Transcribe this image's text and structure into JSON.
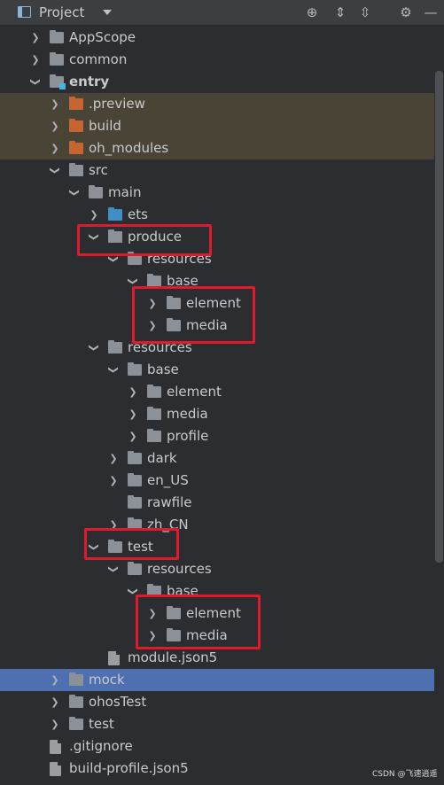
{
  "panel": {
    "title": "Project"
  },
  "toolbar": {
    "locate_icon": "crosshair-icon",
    "expand_icon": "expand-all-icon",
    "collapse_icon": "collapse-all-icon",
    "settings_icon": "gear-icon",
    "hide_icon": "minimize-icon"
  },
  "tree": [
    {
      "label": "AppScope",
      "kind": "folder",
      "state": "collapsed"
    },
    {
      "label": "common",
      "kind": "folder",
      "state": "collapsed"
    },
    {
      "label": "entry",
      "kind": "module-folder",
      "state": "expanded"
    },
    {
      "label": ".preview",
      "kind": "excluded-folder",
      "state": "collapsed"
    },
    {
      "label": "build",
      "kind": "excluded-folder",
      "state": "collapsed"
    },
    {
      "label": "oh_modules",
      "kind": "excluded-folder",
      "state": "collapsed"
    },
    {
      "label": "src",
      "kind": "folder",
      "state": "expanded"
    },
    {
      "label": "main",
      "kind": "folder",
      "state": "expanded"
    },
    {
      "label": "ets",
      "kind": "source-folder",
      "state": "collapsed"
    },
    {
      "label": "produce",
      "kind": "folder",
      "state": "expanded"
    },
    {
      "label": "resources",
      "kind": "folder",
      "state": "expanded"
    },
    {
      "label": "base",
      "kind": "folder",
      "state": "expanded"
    },
    {
      "label": "element",
      "kind": "folder",
      "state": "collapsed"
    },
    {
      "label": "media",
      "kind": "folder",
      "state": "collapsed"
    },
    {
      "label": "resources",
      "kind": "folder",
      "state": "expanded"
    },
    {
      "label": "base",
      "kind": "folder",
      "state": "expanded"
    },
    {
      "label": "element",
      "kind": "folder",
      "state": "collapsed"
    },
    {
      "label": "media",
      "kind": "folder",
      "state": "collapsed"
    },
    {
      "label": "profile",
      "kind": "folder",
      "state": "collapsed"
    },
    {
      "label": "dark",
      "kind": "folder",
      "state": "collapsed"
    },
    {
      "label": "en_US",
      "kind": "folder",
      "state": "collapsed"
    },
    {
      "label": "rawfile",
      "kind": "folder",
      "state": "none"
    },
    {
      "label": "zh_CN",
      "kind": "folder",
      "state": "collapsed"
    },
    {
      "label": "test",
      "kind": "folder",
      "state": "expanded"
    },
    {
      "label": "resources",
      "kind": "folder",
      "state": "expanded"
    },
    {
      "label": "base",
      "kind": "folder",
      "state": "expanded"
    },
    {
      "label": "element",
      "kind": "folder",
      "state": "collapsed"
    },
    {
      "label": "media",
      "kind": "folder",
      "state": "collapsed"
    },
    {
      "label": "module.json5",
      "kind": "file",
      "state": "none"
    },
    {
      "label": "mock",
      "kind": "folder",
      "state": "collapsed",
      "selected": true
    },
    {
      "label": "ohosTest",
      "kind": "folder",
      "state": "collapsed"
    },
    {
      "label": "test",
      "kind": "folder",
      "state": "collapsed"
    },
    {
      "label": ".gitignore",
      "kind": "file",
      "state": "none"
    },
    {
      "label": "build-profile.json5",
      "kind": "file",
      "state": "none"
    }
  ],
  "watermark": "CSDN @飞速逍遥",
  "colors": {
    "background": "#2b2d30",
    "selection": "#4e6fb0",
    "excluded_row": "#4a4436",
    "annotation": "#e0192c"
  }
}
